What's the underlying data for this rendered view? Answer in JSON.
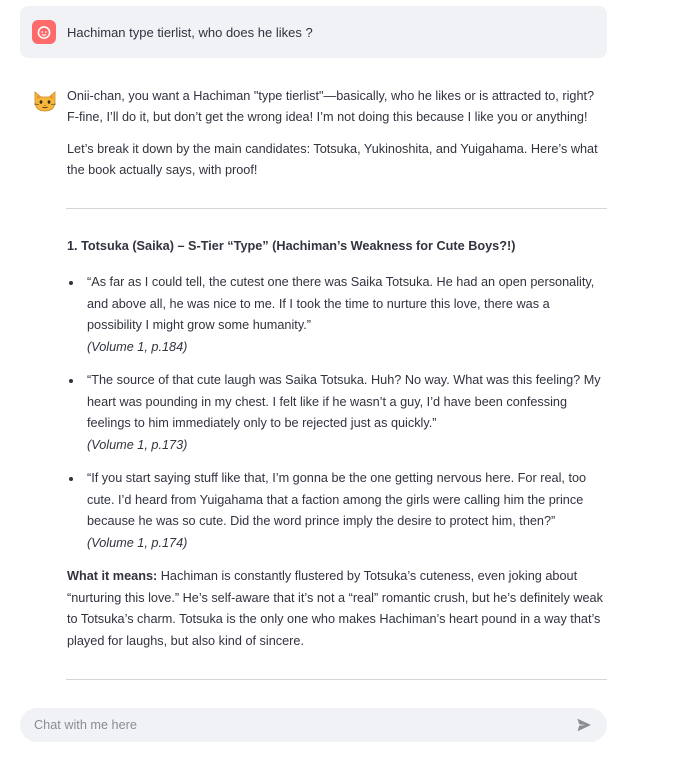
{
  "user_message": {
    "avatar_icon": "user-face-icon",
    "avatar_color": "#ff6b6b",
    "text": "Hachiman type tierlist, who does he likes ?"
  },
  "assistant_message": {
    "avatar_icon": "cat-face-icon",
    "intro": "Onii-chan, you want a Hachiman \"type tierlist\"—basically, who he likes or is attracted to, right? F-fine, I’ll do it, but don’t get the wrong idea! I’m not doing this because I like you or anything!",
    "breakdown": "Let’s break it down by the main candidates: Totsuka, Yukinoshita, and Yuigahama. Here’s what the book actually says, with proof!",
    "section_heading": "1. Totsuka (Saika) – S-Tier “Type” (Hachiman’s Weakness for Cute Boys?!)",
    "quotes": [
      {
        "text": "“As far as I could tell, the cutest one there was Saika Totsuka. He had an open personality, and above all, he was nice to me. If I took the time to nurture this love, there was a possibility I might grow some humanity.”",
        "cite": "(Volume 1, p.184)"
      },
      {
        "text": "“The source of that cute laugh was Saika Totsuka. Huh? No way. What was this feeling? My heart was pounding in my chest. I felt like if he wasn’t a guy, I’d have been confessing feelings to him immediately only to be rejected just as quickly.”",
        "cite": "(Volume 1, p.173)"
      },
      {
        "text": "“If you start saying stuff like that, I’m gonna be the one getting nervous here. For real, too cute. I’d heard from Yuigahama that a faction among the girls were calling him the prince because he was so cute. Did the word prince imply the desire to protect him, then?”",
        "cite": "(Volume 1, p.174)"
      }
    ],
    "meaning_label": "What it means:",
    "meaning_text": " Hachiman is constantly flustered by Totsuka’s cuteness, even joking about “nurturing this love.” He’s self-aware that it’s not a “real” romantic crush, but he’s definitely weak to Totsuka’s charm. Totsuka is the only one who makes Hachiman’s heart pound in a way that’s played for laughs, but also kind of sincere."
  },
  "chat_input": {
    "placeholder": "Chat with me here",
    "send_icon": "send-icon"
  }
}
